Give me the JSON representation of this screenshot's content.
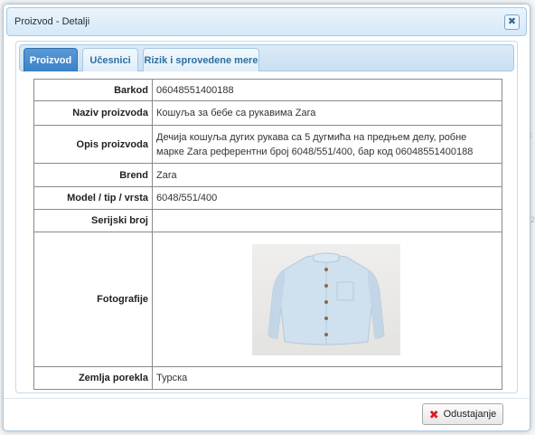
{
  "dialog": {
    "title": "Proizvod - Detalji",
    "close_icon": "close-icon"
  },
  "tabs": [
    {
      "label": "Proizvod",
      "active": true
    },
    {
      "label": "Učesnici",
      "active": false
    },
    {
      "label": "Rizik i sprovedene mere",
      "active": false
    }
  ],
  "details": {
    "barkod": {
      "label": "Barkod",
      "value": "06048551400188"
    },
    "naziv": {
      "label": "Naziv proizvoda",
      "value": "Кошуља за бебе са рукавима Zara"
    },
    "opis": {
      "label": "Opis proizvoda",
      "value": "Дечија кошуља дугих рукава са 5 дугмића на предњем делу, робне марке Zara референтни број 6048/551/400, бар код 06048551400188"
    },
    "brend": {
      "label": "Brend",
      "value": "Zara"
    },
    "model": {
      "label": "Model / tip / vrsta",
      "value": "6048/551/400"
    },
    "serijski": {
      "label": "Serijski broj",
      "value": ""
    },
    "fotografije": {
      "label": "Fotografije",
      "image": "light blue long-sleeve baby shirt"
    },
    "zemlja": {
      "label": "Zemlja porekla",
      "value": "Турска"
    }
  },
  "footer": {
    "cancel_label": "Odustajanje",
    "cancel_icon": "red-x-icon",
    "accent": "#d9201f"
  },
  "colors": {
    "tab_active": "#3b82c7",
    "tab_text": "#2e6e9e",
    "border": "#a6c9e2"
  }
}
